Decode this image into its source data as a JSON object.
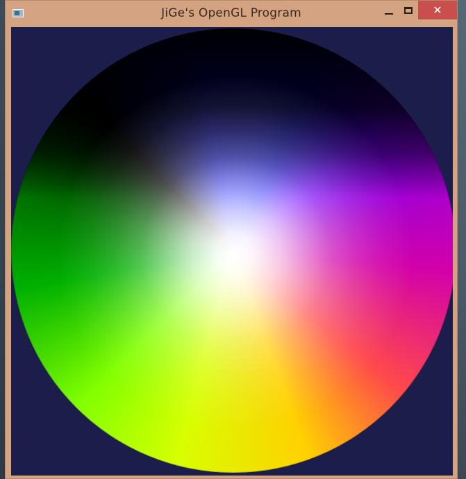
{
  "window": {
    "title": "JiGe's OpenGL Program",
    "app_icon": "window-icon",
    "controls": {
      "minimize_icon": "minimize-icon",
      "maximize_icon": "maximize-icon",
      "close_icon": "close-icon",
      "close_glyph": "✕"
    }
  },
  "colors": {
    "titlebar": "#d4a381",
    "close_button": "#c94f4d",
    "client_background": "#1b1d4b"
  },
  "scene": {
    "object": "color-sphere"
  }
}
